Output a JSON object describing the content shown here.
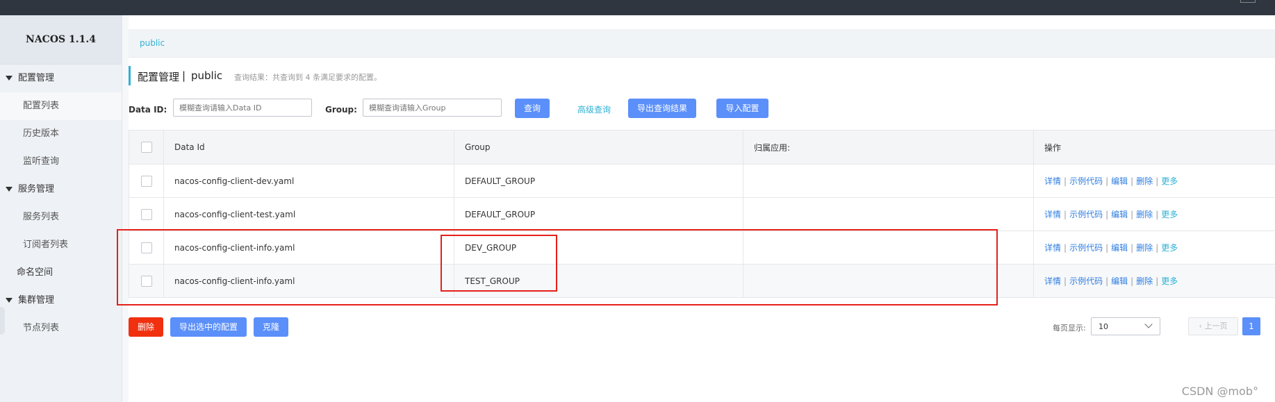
{
  "app": {
    "title": "NACOS 1.1.4"
  },
  "sidebar": {
    "groups": [
      {
        "label": "配置管理",
        "items": [
          "配置列表",
          "历史版本",
          "监听查询"
        ]
      },
      {
        "label": "服务管理",
        "items": [
          "服务列表",
          "订阅者列表"
        ]
      },
      {
        "label": "命名空间"
      },
      {
        "label": "集群管理",
        "items": [
          "节点列表"
        ]
      }
    ]
  },
  "breadcrumb": {
    "namespace": "public"
  },
  "page": {
    "title": "配置管理",
    "separator": "|",
    "namespace": "public",
    "hint": "查询结果：共查询到 4 条满足要求的配置。"
  },
  "filters": {
    "data_id_label": "Data ID:",
    "data_id_placeholder": "模糊查询请输入Data ID",
    "group_label": "Group:",
    "group_placeholder": "模糊查询请输入Group",
    "query_button": "查询",
    "advanced_link": "高级查询",
    "export_button": "导出查询结果",
    "import_button": "导入配置"
  },
  "table": {
    "columns": [
      "Data Id",
      "Group",
      "归属应用:",
      "操作"
    ],
    "rows": [
      {
        "data_id": "nacos-config-client-dev.yaml",
        "group": "DEFAULT_GROUP",
        "app": ""
      },
      {
        "data_id": "nacos-config-client-test.yaml",
        "group": "DEFAULT_GROUP",
        "app": ""
      },
      {
        "data_id": "nacos-config-client-info.yaml",
        "group": "DEV_GROUP",
        "app": ""
      },
      {
        "data_id": "nacos-config-client-info.yaml",
        "group": "TEST_GROUP",
        "app": ""
      }
    ],
    "ops": {
      "detail": "详情",
      "sample": "示例代码",
      "edit": "编辑",
      "delete": "删除",
      "more": "更多",
      "sep": "|"
    }
  },
  "bulk": {
    "delete": "删除",
    "export_selected": "导出选中的配置",
    "clone": "克隆"
  },
  "pagination": {
    "page_size_label": "每页显示:",
    "page_size": "10",
    "prev": "上一页",
    "current_page": "1"
  },
  "watermark": "CSDN @mob°",
  "colors": {
    "accent": "#5b8ff9",
    "link": "#2e7de1",
    "teal": "#2eb1d4",
    "danger": "#e5201a",
    "topbar": "#2f3640"
  }
}
